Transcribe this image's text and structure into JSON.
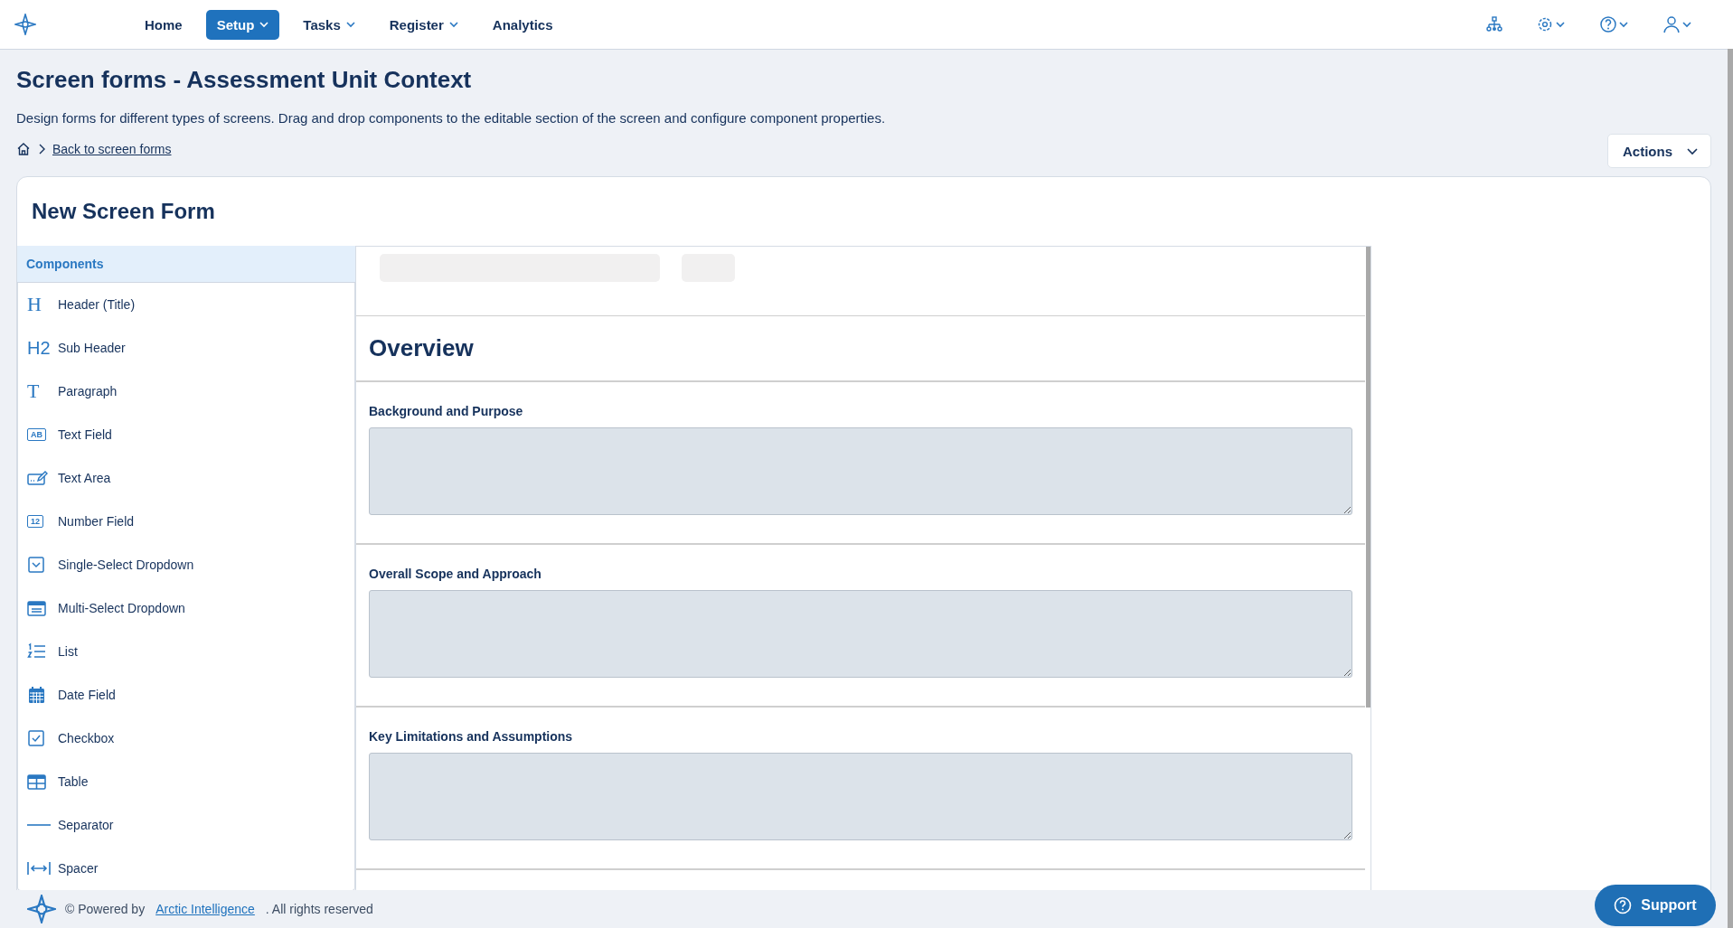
{
  "nav": {
    "items": [
      {
        "label": "Home",
        "selected": false,
        "dropdown": false
      },
      {
        "label": "Setup",
        "selected": true,
        "dropdown": true
      },
      {
        "label": "Tasks",
        "selected": false,
        "dropdown": true
      },
      {
        "label": "Register",
        "selected": false,
        "dropdown": true
      },
      {
        "label": "Analytics",
        "selected": false,
        "dropdown": false
      }
    ]
  },
  "page": {
    "title": "Screen forms - Assessment Unit Context",
    "description": "Design forms for different types of screens. Drag and drop components to the editable section of the screen and configure component properties.",
    "breadcrumb": "Back to screen forms",
    "actions": "Actions"
  },
  "form": {
    "title": "New Screen Form",
    "components": {
      "header": "Components",
      "items": [
        {
          "kind": "glyph",
          "glyph": "H",
          "label": "Header (Title)"
        },
        {
          "kind": "glyph",
          "glyph": "H2",
          "label": "Sub Header"
        },
        {
          "kind": "glyph",
          "glyph": "T",
          "label": "Paragraph"
        },
        {
          "kind": "boxed",
          "glyph": "AB",
          "label": "Text Field"
        },
        {
          "kind": "textarea",
          "label": "Text Area"
        },
        {
          "kind": "boxed",
          "glyph": "12",
          "label": "Number Field"
        },
        {
          "kind": "select",
          "label": "Single-Select Dropdown"
        },
        {
          "kind": "multiselect",
          "label": "Multi-Select Dropdown"
        },
        {
          "kind": "list",
          "label": "List"
        },
        {
          "kind": "date",
          "label": "Date Field"
        },
        {
          "kind": "checkbox",
          "label": "Checkbox"
        },
        {
          "kind": "table",
          "label": "Table"
        },
        {
          "kind": "separator",
          "label": "Separator"
        },
        {
          "kind": "spacer",
          "label": "Spacer"
        }
      ]
    },
    "sections": [
      {
        "kind": "heading",
        "text": "Overview"
      },
      {
        "kind": "textarea",
        "label": "Background and Purpose"
      },
      {
        "kind": "textarea",
        "label": "Overall Scope and Approach"
      },
      {
        "kind": "textarea",
        "label": "Key Limitations and Assumptions"
      }
    ]
  },
  "footer": {
    "prefix": "© Powered by",
    "link": "Arctic Intelligence",
    "suffix": ". All rights reserved",
    "support": "Support"
  }
}
